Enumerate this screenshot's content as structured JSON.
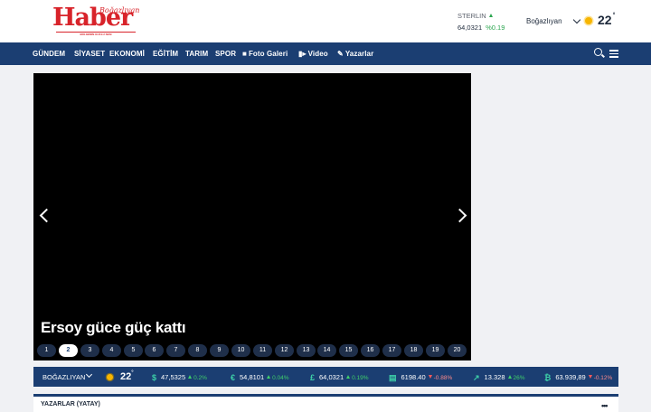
{
  "header": {
    "logo_text": "Haber",
    "logo_city": "Boğazlıyan",
    "logo_slogan": "BOLGENIN GUCLU SESI",
    "currency_name": "STERLIN",
    "currency_value": "64,0321",
    "currency_change": "%0.19",
    "city": "Boğazlıyan",
    "temperature": "22",
    "degree": "°"
  },
  "nav": {
    "items": [
      "GÜNDEM",
      "SİYASET",
      "EKONOMİ",
      "EĞİTİM",
      "TARIM",
      "SPOR",
      "Foto Galeri",
      "Video",
      "Yazarlar"
    ]
  },
  "slider": {
    "title": "Ersoy güce güç kattı",
    "pages": [
      "1",
      "2",
      "3",
      "4",
      "5",
      "6",
      "7",
      "8",
      "9",
      "10",
      "11",
      "12",
      "13",
      "14",
      "15",
      "16",
      "17",
      "18",
      "19",
      "20"
    ],
    "active_page": "2"
  },
  "ticker": {
    "city": "BOĞAZLIYAN",
    "temperature": "22",
    "degree": "°",
    "items": [
      {
        "icon": "$",
        "value": "47,5325",
        "change": "0.2%",
        "dir": "up"
      },
      {
        "icon": "€",
        "value": "54,8101",
        "change": "0.04%",
        "dir": "up"
      },
      {
        "icon": "£",
        "value": "64,0321",
        "change": "0.19%",
        "dir": "up"
      },
      {
        "icon": "▤",
        "value": "6198.40",
        "change": "-0.88%",
        "dir": "down"
      },
      {
        "icon": "↗",
        "value": "13.328",
        "change": "26%",
        "dir": "up"
      },
      {
        "icon": "₿",
        "value": "63.939,89",
        "change": "-0.12%",
        "dir": "down"
      }
    ]
  },
  "section": {
    "title": "YAZARLAR (YATAY)",
    "more": "•••"
  },
  "colors": {
    "brand_red": "#d8232a",
    "nav_blue": "#1b3e72",
    "positive": "#2aa54e",
    "negative": "#ff5a5a"
  }
}
